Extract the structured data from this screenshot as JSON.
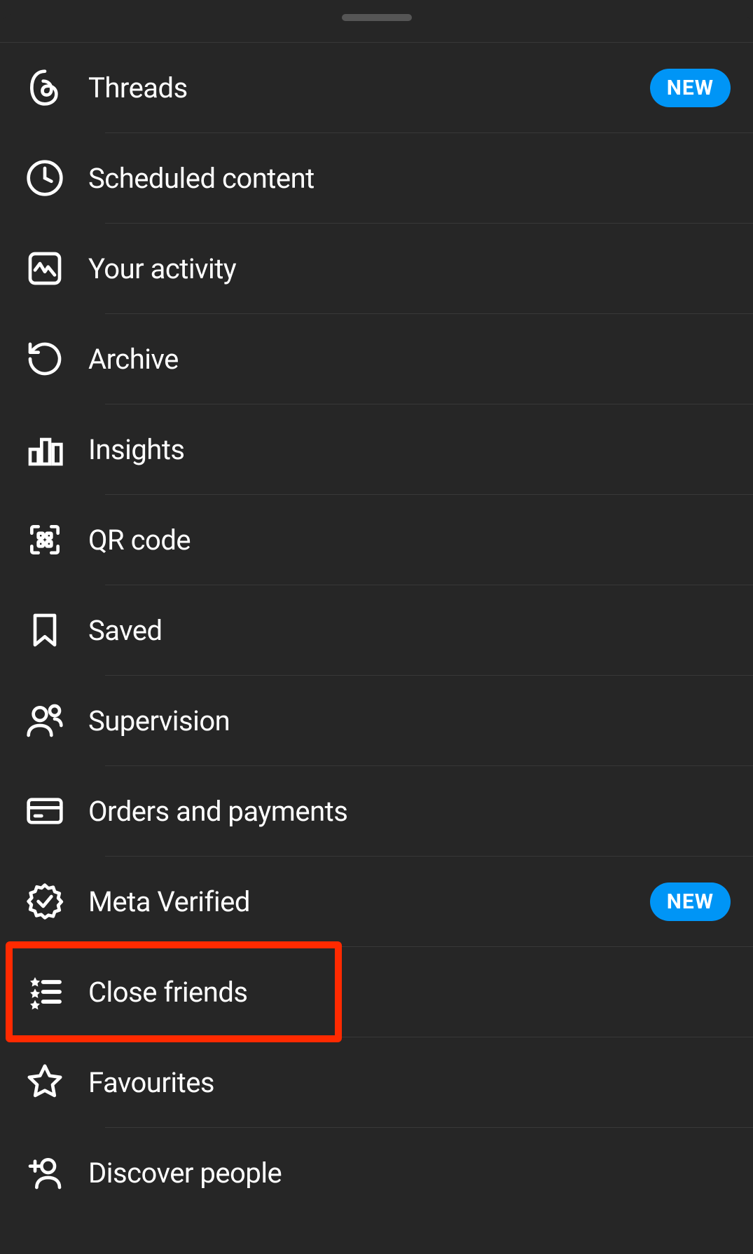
{
  "menu": {
    "items": [
      {
        "id": "threads",
        "label": "Threads",
        "badge": "NEW",
        "icon": "threads-icon"
      },
      {
        "id": "scheduled",
        "label": "Scheduled content",
        "icon": "clock-icon"
      },
      {
        "id": "activity",
        "label": "Your activity",
        "icon": "activity-icon"
      },
      {
        "id": "archive",
        "label": "Archive",
        "icon": "archive-icon"
      },
      {
        "id": "insights",
        "label": "Insights",
        "icon": "insights-icon"
      },
      {
        "id": "qrcode",
        "label": "QR code",
        "icon": "qr-icon"
      },
      {
        "id": "saved",
        "label": "Saved",
        "icon": "bookmark-icon"
      },
      {
        "id": "supervision",
        "label": "Supervision",
        "icon": "supervision-icon"
      },
      {
        "id": "orders",
        "label": "Orders and payments",
        "icon": "card-icon"
      },
      {
        "id": "verified",
        "label": "Meta Verified",
        "badge": "NEW",
        "icon": "verified-icon"
      },
      {
        "id": "closefriends",
        "label": "Close friends",
        "icon": "closefriends-icon",
        "highlighted": true
      },
      {
        "id": "favourites",
        "label": "Favourites",
        "icon": "star-icon"
      },
      {
        "id": "discover",
        "label": "Discover people",
        "icon": "adduser-icon"
      }
    ]
  },
  "colors": {
    "background": "#262626",
    "text": "#ffffff",
    "divider": "#383838",
    "badge": "#0095f6",
    "highlight": "#ff2a00"
  }
}
